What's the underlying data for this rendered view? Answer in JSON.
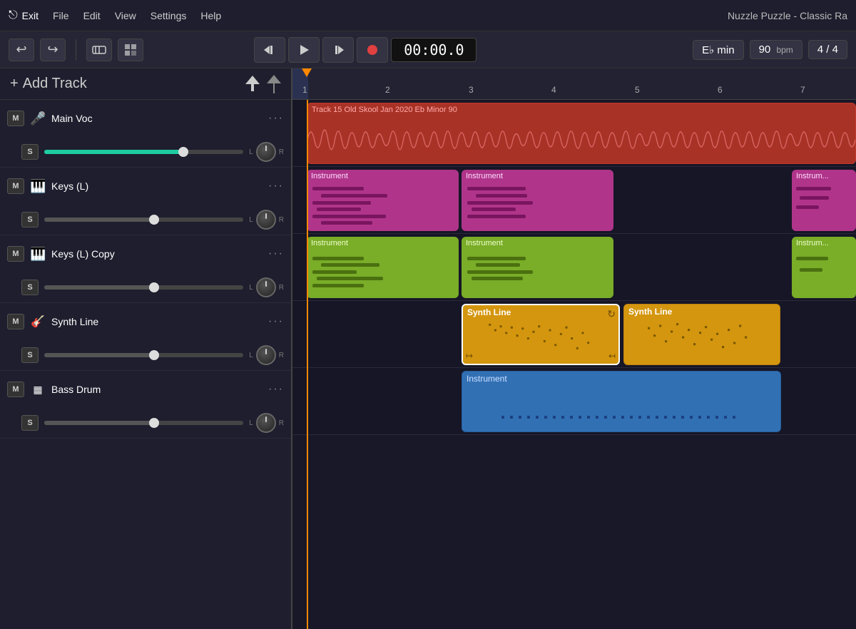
{
  "app": {
    "title": "Nuzzle Puzzle - Classic Ra"
  },
  "menu": {
    "exit_label": "Exit",
    "items": [
      "File",
      "Edit",
      "View",
      "Settings",
      "Help"
    ]
  },
  "toolbar": {
    "undo_label": "↩",
    "redo_label": "↪",
    "loop_label": "⬜",
    "grid_label": "⬛"
  },
  "transport": {
    "rewind_label": "⏮",
    "play_label": "▶",
    "skip_label": "⏭",
    "record_label": "●",
    "time": "00:00.0",
    "key": "E♭ min",
    "bpm": "90",
    "bpm_label": "bpm",
    "time_sig": "4 / 4"
  },
  "add_track": {
    "label": "Add Track"
  },
  "tracks": [
    {
      "id": "main-voc",
      "name": "Main Voc",
      "icon": "🎤",
      "mute": "M",
      "solo": "S",
      "volume_pct": 70,
      "volume_color": "#1ecba0"
    },
    {
      "id": "keys-l",
      "name": "Keys (L)",
      "icon": "🎹",
      "mute": "M",
      "solo": "S",
      "volume_pct": 55,
      "volume_color": "#555"
    },
    {
      "id": "keys-l-copy",
      "name": "Keys (L) Copy",
      "icon": "🎹",
      "mute": "M",
      "solo": "S",
      "volume_pct": 55,
      "volume_color": "#555"
    },
    {
      "id": "synth-line",
      "name": "Synth Line",
      "icon": "🎸",
      "mute": "M",
      "solo": "S",
      "volume_pct": 55,
      "volume_color": "#555"
    },
    {
      "id": "bass-drum",
      "name": "Bass Drum",
      "icon": "▦",
      "mute": "M",
      "solo": "S",
      "volume_pct": 55,
      "volume_color": "#555"
    }
  ],
  "ruler": {
    "marks": [
      1,
      2,
      3,
      4,
      5,
      6,
      7
    ]
  },
  "clips": {
    "main_voc": {
      "label": "Track 15 Old Skool Jan 2020 Eb Minor 90",
      "color": "#c0392b",
      "bg": "#a93226"
    },
    "keys_1a": {
      "label": "Instrument",
      "color": "#c0409c"
    },
    "keys_1b": {
      "label": "Instrument",
      "color": "#c0409c"
    },
    "keys_1c": {
      "label": "Instrument",
      "color": "#c0409c"
    },
    "keys_2a": {
      "label": "Instrument",
      "color": "#7dbb2d"
    },
    "keys_2b": {
      "label": "Instrument",
      "color": "#7dbb2d"
    },
    "keys_2c": {
      "label": "Instrument",
      "color": "#7dbb2d"
    },
    "synth_a": {
      "label": "Synth Line",
      "color": "#e5a820"
    },
    "synth_b": {
      "label": "Synth Line",
      "color": "#e5a820"
    },
    "bass_a": {
      "label": "Instrument",
      "color": "#3b82c4"
    }
  }
}
